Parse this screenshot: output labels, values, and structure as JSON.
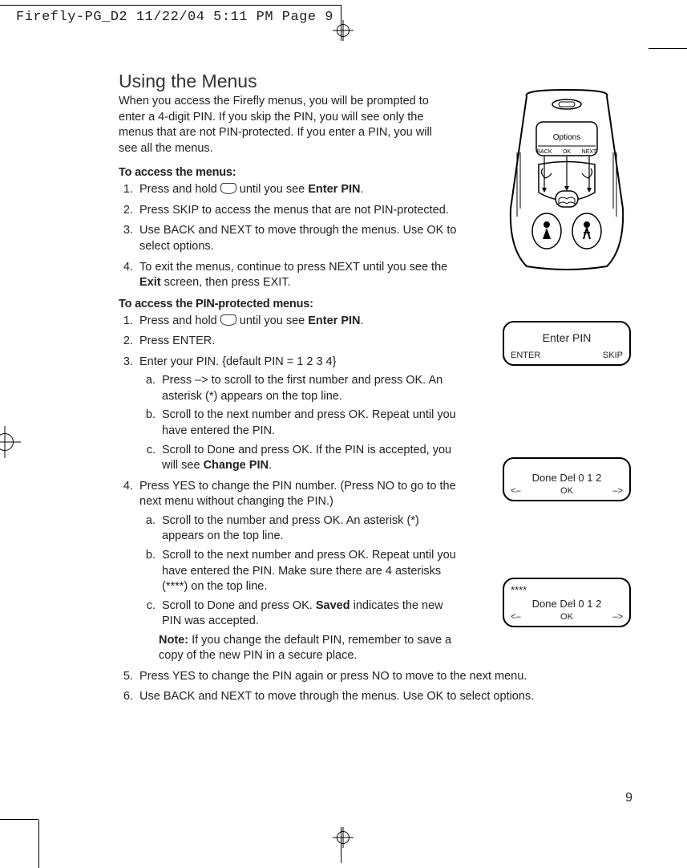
{
  "slug": "Firefly-PG_D2  11/22/04  5:11 PM  Page 9",
  "title": "Using the Menus",
  "intro": "When you access the Firefly menus, you will be prompted to enter a 4-digit PIN. If you skip the PIN, you will see only the menus that are not PIN-protected. If you enter a PIN, you will see all the menus.",
  "sec1_head": "To access the menus:",
  "sec1": {
    "i1a": "Press and hold ",
    "i1b": " until you see ",
    "i1c": "Enter PIN",
    "i1d": ".",
    "i2": "Press SKIP to access the menus that are not PIN-protected.",
    "i3": "Use BACK and NEXT to move through the menus. Use OK to select options.",
    "i4a": "To exit the menus, continue to press NEXT until you see the ",
    "i4b": "Exit",
    "i4c": " screen, then press EXIT."
  },
  "sec2_head": "To access the PIN-protected menus:",
  "sec2": {
    "i1a": "Press and hold ",
    "i1b": " until you see ",
    "i1c": "Enter PIN",
    "i1d": ".",
    "i2": "Press ENTER.",
    "i3": "Enter your PIN. {default PIN = 1 2 3 4}",
    "i3a": "Press –> to scroll to the first number and press OK. An asterisk (*) appears on the top line.",
    "i3b": "Scroll to the next number and press OK. Repeat until you have entered the PIN.",
    "i3c_a": "Scroll to Done and press OK. If the PIN is accepted, you will see ",
    "i3c_b": "Change PIN",
    "i3c_c": ".",
    "i4": "Press YES to change the PIN number. (Press NO to go to the next menu without changing the PIN.)",
    "i4a": "Scroll to the number and press OK. An asterisk (*) appears on the top line.",
    "i4b": "Scroll to the next number and press OK. Repeat until you have entered the PIN. Make sure there are 4 asterisks (****) on the top line.",
    "i4c_a": "Scroll to Done and press OK. ",
    "i4c_b": "Saved",
    "i4c_c": " indicates the new PIN was accepted.",
    "note_label": "Note:  ",
    "note": "If you change the default PIN, remember to save a copy of the new PIN in a secure place.",
    "i5": "Press YES to change the PIN again or press NO to move to the next menu.",
    "i6": "Use BACK and NEXT to move through the menus. Use OK to select options."
  },
  "device": {
    "options": "Options",
    "back": "BACK",
    "ok": "OK",
    "next": "NEXT"
  },
  "screen1": {
    "title": "Enter PIN",
    "left": "ENTER",
    "right": "SKIP"
  },
  "screen2": {
    "line": "Done   Del   0  1  2",
    "left": "<–",
    "mid": "OK",
    "right": "–>"
  },
  "screen3": {
    "stars": "****",
    "line": "Done   Del   0  1  2",
    "left": "<–",
    "mid": "OK",
    "right": "–>"
  },
  "page_number": "9"
}
